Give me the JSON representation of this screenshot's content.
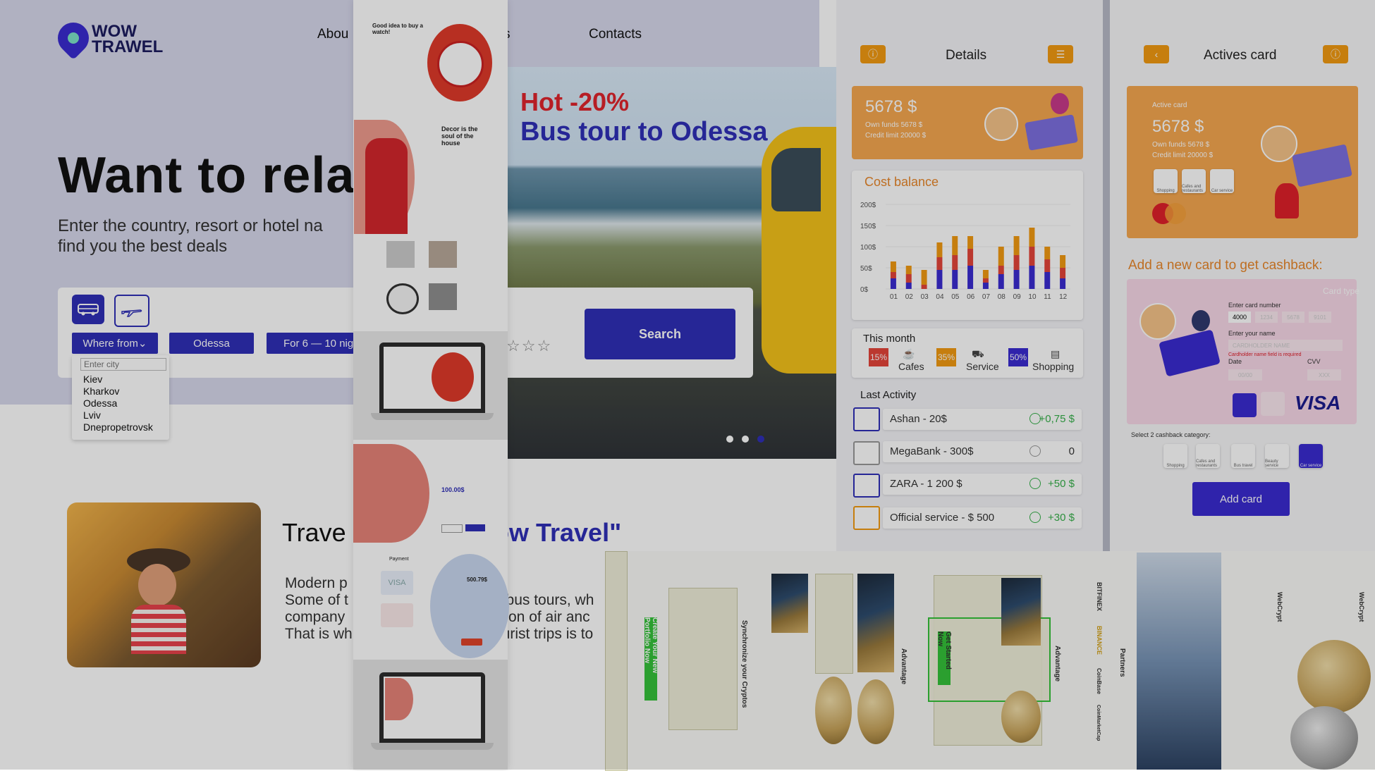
{
  "travel": {
    "logo": {
      "line1": "WOW",
      "line2": "TRAWEL"
    },
    "nav": [
      "Abou",
      "s",
      "Contacts"
    ],
    "hero_title": "Want to relax",
    "hero_sub_1": "Enter the  country, resort or hotel na",
    "hero_sub_2": "find you the best deals",
    "transport": [
      "bus-icon",
      "plane-icon"
    ],
    "where_from": "Where from",
    "destination": "Odessa",
    "duration": "For 6 — 10 nig",
    "city_placeholder": "Enter city",
    "cities": [
      "Kiev",
      "Kharkov",
      "Odessa",
      "Lviv",
      "Dnepropetrovsk"
    ],
    "promo_line1": "Hot -20%",
    "promo_line2": "Bus tour to Odessa",
    "search_label": "Search",
    "rating_stars": "☆☆☆",
    "slider_dots": 3,
    "slider_active": 3,
    "about_title_left": "Trave",
    "about_title_right": "ow Travel\"",
    "about_lines_left": [
      "Modern p",
      "Some of t",
      "company",
      "That is wh"
    ],
    "about_lines_right": [
      "n bus tours, wh",
      "ction of air anc",
      "ourist trips is to"
    ]
  },
  "mockups": {
    "watch_heading": "Good idea to buy a watch!",
    "decor_heading": "Decor is the soul of the house",
    "price": "100.00$",
    "payment_label": "Payment",
    "visa": "VISA",
    "sum": "500.79$"
  },
  "details": {
    "title": "Details",
    "card_amount": "5678 $",
    "own_funds": "Own funds  5678 $",
    "credit_limit": "Credit limit  20000 $",
    "cost_balance_title": "Cost balance",
    "y_ticks": [
      "200$",
      "150$",
      "100$",
      "50$",
      "0$"
    ],
    "this_month": "This month",
    "categories": [
      {
        "pct": "15%",
        "label": "Cafes",
        "color": "#e5453a"
      },
      {
        "pct": "35%",
        "label": "Service",
        "color": "#f29a12"
      },
      {
        "pct": "50%",
        "label": "Shopping",
        "color": "#3a2bd1"
      }
    ],
    "last_activity": "Last Activity",
    "activities": [
      {
        "name": "Ashan - 20$",
        "amount": "+0,75 $",
        "icon": "basket-icon"
      },
      {
        "name": "MegaBank - 300$",
        "amount": "0",
        "icon": "bank-icon"
      },
      {
        "name": "ZARA - 1 200 $",
        "amount": "+50 $",
        "icon": "shirt-icon"
      },
      {
        "name": "Official service - $ 500",
        "amount": "+30 $",
        "icon": "car-icon"
      }
    ]
  },
  "chart_data": {
    "type": "bar",
    "title": "Cost balance",
    "categories": [
      "01",
      "02",
      "03",
      "04",
      "05",
      "06",
      "07",
      "08",
      "09",
      "10",
      "11",
      "12"
    ],
    "series": [
      {
        "name": "Shopping",
        "values": [
          25,
          15,
          0,
          45,
          45,
          55,
          15,
          35,
          45,
          55,
          40,
          25
        ]
      },
      {
        "name": "Cafes",
        "values": [
          15,
          20,
          10,
          30,
          35,
          40,
          10,
          20,
          35,
          45,
          30,
          25
        ]
      },
      {
        "name": "Service",
        "values": [
          25,
          20,
          35,
          35,
          45,
          30,
          20,
          45,
          45,
          45,
          30,
          30
        ]
      }
    ],
    "ylim": [
      0,
      200
    ],
    "y_ticks": [
      "200$",
      "150$",
      "100$",
      "50$",
      "0$"
    ],
    "colors": [
      "#3a2bd1",
      "#e5453a",
      "#f29a12"
    ]
  },
  "actives": {
    "title": "Actives card",
    "active_card": "Active card",
    "amount": "5678 $",
    "own_funds": "Own funds  5678 $",
    "credit_limit": "Credit limit  20000 $",
    "mini_cats": [
      "Shopping",
      "Cafes and restaurants",
      "Car service"
    ],
    "cashback_title": "Add a new card to get cashback:",
    "card_type": "Card type",
    "enter_number": "Enter card number",
    "number_part": "4000",
    "number_ghost": [
      "1234",
      "5678",
      "9101"
    ],
    "enter_name": "Enter your name",
    "name_placeholder": "CARDHOLDER NAME",
    "name_required": "Cardholder name field is required",
    "date_label": "Date",
    "date_placeholder": "00/00",
    "cvv_label": "CVV",
    "cvv_placeholder": "XXX",
    "visa": "VISA",
    "select_label": "Select  2 cashback category:",
    "cashback_cats": [
      "Shopping",
      "Cafes and restaurants",
      "Bus travel",
      "Beauty service",
      "Car service"
    ],
    "add_card": "Add card"
  },
  "crypto": {
    "create": "Create Your New Portfolio Now",
    "sync": "Synchronize your Cryptos",
    "advantage": "Advantage",
    "get_started": "Get Started Now",
    "partners": "Partners",
    "partner_names": [
      "BITFINEX",
      "BINANCE",
      "CoinBase",
      "CoinMarketCap"
    ],
    "brand": "WebCrypt"
  }
}
